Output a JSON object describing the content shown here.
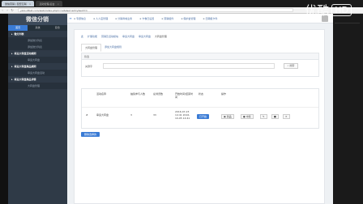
{
  "browser": {
    "tabs": [
      {
        "label": "微信营销 | 配套互联",
        "active": true
      },
      {
        "label": "活动管理-后台",
        "active": false
      }
    ],
    "url": "yzzo.ldbat.com/web/index.php?c=site&a=entry&eid=1"
  },
  "watermark": {
    "logo": "优酷",
    "badge": "HD"
  },
  "sidebar": {
    "brand": "微信分销",
    "tabs": [
      "首页",
      "系统",
      "复合"
    ],
    "menu": [
      {
        "type": "group",
        "label": "微分列表"
      },
      {
        "type": "sub",
        "label": "添加微分列表"
      },
      {
        "type": "sub",
        "label": "添加微分列表"
      },
      {
        "type": "group",
        "label": "幸运大转盘活动规则"
      },
      {
        "type": "sub",
        "label": "幸运大转盘"
      },
      {
        "type": "group",
        "label": "幸运大转盘商品规则"
      },
      {
        "type": "sub",
        "label": "幸运大转盘活动"
      },
      {
        "type": "group",
        "label": "幸运大转盘商品详情"
      },
      {
        "type": "sub",
        "label": "大转盘管理"
      }
    ]
  },
  "topnav": {
    "items": [
      "专题信息",
      "人人店管理",
      "分销商城业务",
      "卡卷日设置",
      "营销组件",
      "保护金管理",
      "日期组卡件"
    ]
  },
  "breadcrumb": [
    "此",
    "扩展功能",
    "营销及活动模块",
    "幸运大转盘",
    "幸运大转盘",
    "大转盘管理"
  ],
  "panel_tabs": [
    "大转盘管理",
    "添加大转盘规则"
  ],
  "filter": {
    "title": "筛选",
    "keyword_label": "关键字",
    "keyword_value": "",
    "search_button": "搜索"
  },
  "table": {
    "headers": [
      "",
      "活动名称",
      "抽奖参与人数",
      "总浏览数",
      "开始时间/结束时间",
      "状态",
      "操作"
    ],
    "rows": [
      {
        "id": "#",
        "name": "幸运大转盘",
        "participants": "3",
        "views": "33",
        "time": "2016-07-23 14:41 2016-10-05 14:41",
        "status": "已开始",
        "actions": [
          "奖品",
          "中奖",
          "",
          "",
          ""
        ]
      }
    ]
  },
  "delete_button": "删除选择的",
  "colors": {
    "accent": "#3a7bd5",
    "sidebar": "#2f3a47",
    "bg": "#eef1f4"
  }
}
